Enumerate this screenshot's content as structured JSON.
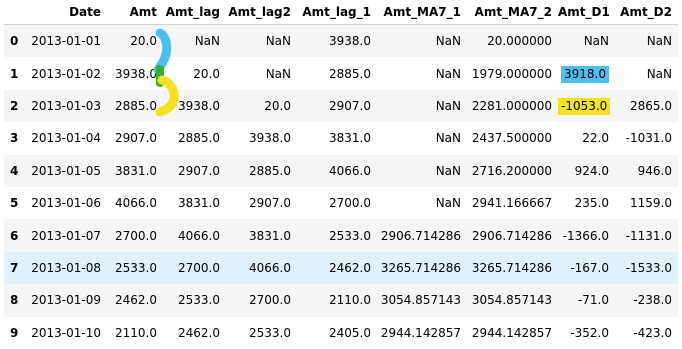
{
  "table": {
    "columns": [
      "",
      "Date",
      "Amt",
      "Amt_lag",
      "Amt_lag2",
      "Amt_lag_1",
      "Amt_MA7_1",
      "Amt_MA7_2",
      "Amt_D1",
      "Amt_D2"
    ],
    "rows": [
      {
        "index": "0",
        "cells": [
          "2013-01-01",
          "20.0",
          "NaN",
          "NaN",
          "3938.0",
          "NaN",
          "20.000000",
          "NaN",
          "NaN"
        ]
      },
      {
        "index": "1",
        "cells": [
          "2013-01-02",
          "3938.0",
          "20.0",
          "NaN",
          "2885.0",
          "NaN",
          "1979.000000",
          "3918.0",
          "NaN"
        ]
      },
      {
        "index": "2",
        "cells": [
          "2013-01-03",
          "2885.0",
          "3938.0",
          "20.0",
          "2907.0",
          "NaN",
          "2281.000000",
          "-1053.0",
          "2865.0"
        ]
      },
      {
        "index": "3",
        "cells": [
          "2013-01-04",
          "2907.0",
          "2885.0",
          "3938.0",
          "3831.0",
          "NaN",
          "2437.500000",
          "22.0",
          "-1031.0"
        ]
      },
      {
        "index": "4",
        "cells": [
          "2013-01-05",
          "3831.0",
          "2907.0",
          "2885.0",
          "4066.0",
          "NaN",
          "2716.200000",
          "924.0",
          "946.0"
        ]
      },
      {
        "index": "5",
        "cells": [
          "2013-01-06",
          "4066.0",
          "3831.0",
          "2907.0",
          "2700.0",
          "NaN",
          "2941.166667",
          "235.0",
          "1159.0"
        ]
      },
      {
        "index": "6",
        "cells": [
          "2013-01-07",
          "2700.0",
          "4066.0",
          "3831.0",
          "2533.0",
          "2906.714286",
          "2906.714286",
          "-1366.0",
          "-1131.0"
        ]
      },
      {
        "index": "7",
        "cells": [
          "2013-01-08",
          "2533.0",
          "2700.0",
          "4066.0",
          "2462.0",
          "3265.714286",
          "3265.714286",
          "-167.0",
          "-1533.0"
        ]
      },
      {
        "index": "8",
        "cells": [
          "2013-01-09",
          "2462.0",
          "2533.0",
          "2700.0",
          "2110.0",
          "3054.857143",
          "3054.857143",
          "-71.0",
          "-238.0"
        ]
      },
      {
        "index": "9",
        "cells": [
          "2013-01-10",
          "2110.0",
          "2462.0",
          "2533.0",
          "2405.0",
          "2944.142857",
          "2944.142857",
          "-352.0",
          "-423.0"
        ]
      }
    ]
  },
  "highlights": [
    {
      "row": 1,
      "col": 7,
      "color": "#4dbfee"
    },
    {
      "row": 2,
      "col": 7,
      "color": "#f5e11c"
    }
  ],
  "hover_row": 7,
  "markers": {
    "blue": "#4dbfee",
    "green": "#2db52d",
    "yellow": "#f5e11c"
  }
}
